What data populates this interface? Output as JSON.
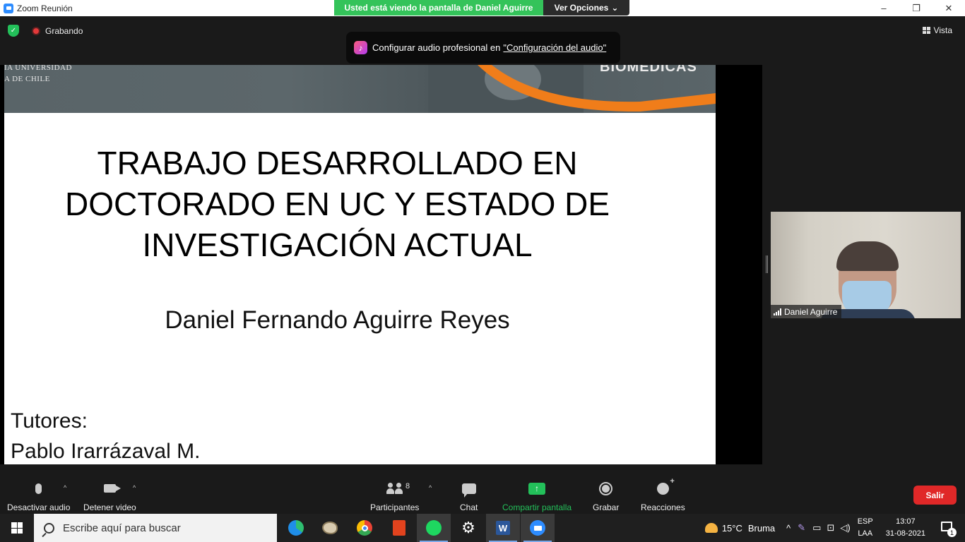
{
  "window": {
    "title": "Zoom Reunión",
    "minimize": "–",
    "restore": "❐",
    "close": "✕"
  },
  "share_banner": {
    "viewing_text": "Usted está viendo la pantalla de Daniel Aguirre",
    "options_label": "Ver Opciones",
    "options_caret": "⌄"
  },
  "meeting_bar": {
    "recording_label": "Grabando",
    "view_label": "Vista"
  },
  "audio_tip": {
    "text": "Configurar audio profesional en",
    "link": "\"Configuración del audio\"",
    "icon": "♪"
  },
  "slide": {
    "header_brand_line1": "IA UNIVERSIDAD",
    "header_brand_line2": "A DE CHILE",
    "header_right_brand": "BIOMÉDICAS",
    "title_line1": "TRABAJO DESARROLLADO EN",
    "title_line2": "DOCTORADO EN UC Y ESTADO DE",
    "title_line3": "INVESTIGACIÓN ACTUAL",
    "author": "Daniel Fernando Aguirre Reyes",
    "tutors_label": "Tutores:",
    "tutor_1": "Pablo Irarrázaval M."
  },
  "video_tile": {
    "participant_name": "Daniel Aguirre"
  },
  "toolbar": {
    "mute_label": "Desactivar audio",
    "video_label": "Detener video",
    "participants_label": "Participantes",
    "participants_count": "8",
    "chat_label": "Chat",
    "share_label": "Compartir pantalla",
    "share_icon": "↑",
    "record_label": "Grabar",
    "reactions_label": "Reacciones",
    "leave_label": "Salir",
    "caret": "^"
  },
  "taskbar": {
    "search_placeholder": "Escribe aquí para buscar",
    "weather_temp": "15°C",
    "weather_desc": "Bruma",
    "tray_chevron": "^",
    "lang_line1": "ESP",
    "lang_line2": "LAA",
    "time": "13:07",
    "date": "31-08-2021",
    "notification_count": "1"
  },
  "colors": {
    "zoom_green": "#23c05a",
    "leave_red": "#e02828",
    "slide_orange": "#f07d1a",
    "zoom_blue": "#2d8cff"
  }
}
